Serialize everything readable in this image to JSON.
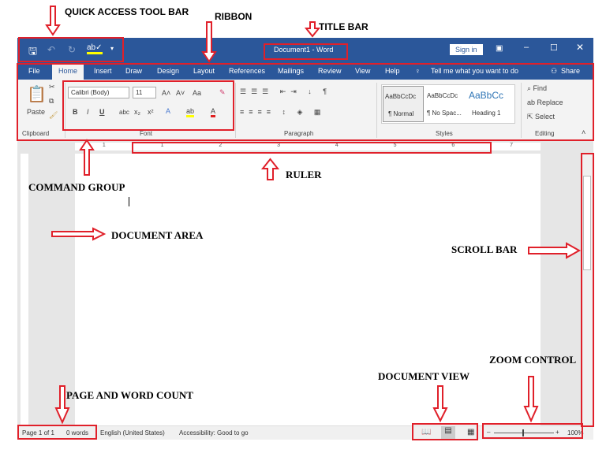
{
  "annotations": {
    "qat": "QUICK ACCESS TOOL BAR",
    "ribbon": "RIBBON",
    "title_bar": "TITLE BAR",
    "ruler": "RULER",
    "command_group": "COMMAND GROUP",
    "document_area": "DOCUMENT AREA",
    "scroll_bar": "SCROLL BAR",
    "zoom_control": "ZOOM CONTROL",
    "document_view": "DOCUMENT VIEW",
    "page_word_count": "PAGE AND WORD COUNT"
  },
  "title_bar": {
    "title": "Document1  -  Word",
    "sign_in": "Sign in"
  },
  "tabs": [
    "File",
    "Home",
    "Insert",
    "Draw",
    "Design",
    "Layout",
    "References",
    "Mailings",
    "Review",
    "View",
    "Help"
  ],
  "tell_me": "Tell me what you want to do",
  "share": "Share",
  "clipboard": {
    "paste": "Paste",
    "label": "Clipboard"
  },
  "font": {
    "name": "Calibri (Body)",
    "size": "11",
    "label": "Font",
    "case": "Aa",
    "bold": "B",
    "italic": "I",
    "underline": "U",
    "strike": "abc",
    "sub": "x₂",
    "sup": "x²"
  },
  "paragraph": {
    "label": "Paragraph"
  },
  "styles": {
    "label": "Styles",
    "items": [
      {
        "preview": "AaBbCcDc",
        "name": "¶ Normal"
      },
      {
        "preview": "AaBbCcDc",
        "name": "¶ No Spac..."
      },
      {
        "preview": "AaBbCc",
        "name": "Heading 1"
      }
    ]
  },
  "editing": {
    "label": "Editing",
    "find": "Find",
    "replace": "Replace",
    "select": "Select"
  },
  "ruler": {
    "numbers": [
      "1",
      "1",
      "2",
      "3",
      "4",
      "5",
      "6",
      "7"
    ]
  },
  "status": {
    "page": "Page 1 of 1",
    "words": "0 words",
    "language": "English (United States)",
    "accessibility": "Accessibility: Good to go",
    "zoom": "100%"
  },
  "colors": {
    "word_blue": "#2b579a",
    "annotation_red": "#e0202a"
  }
}
